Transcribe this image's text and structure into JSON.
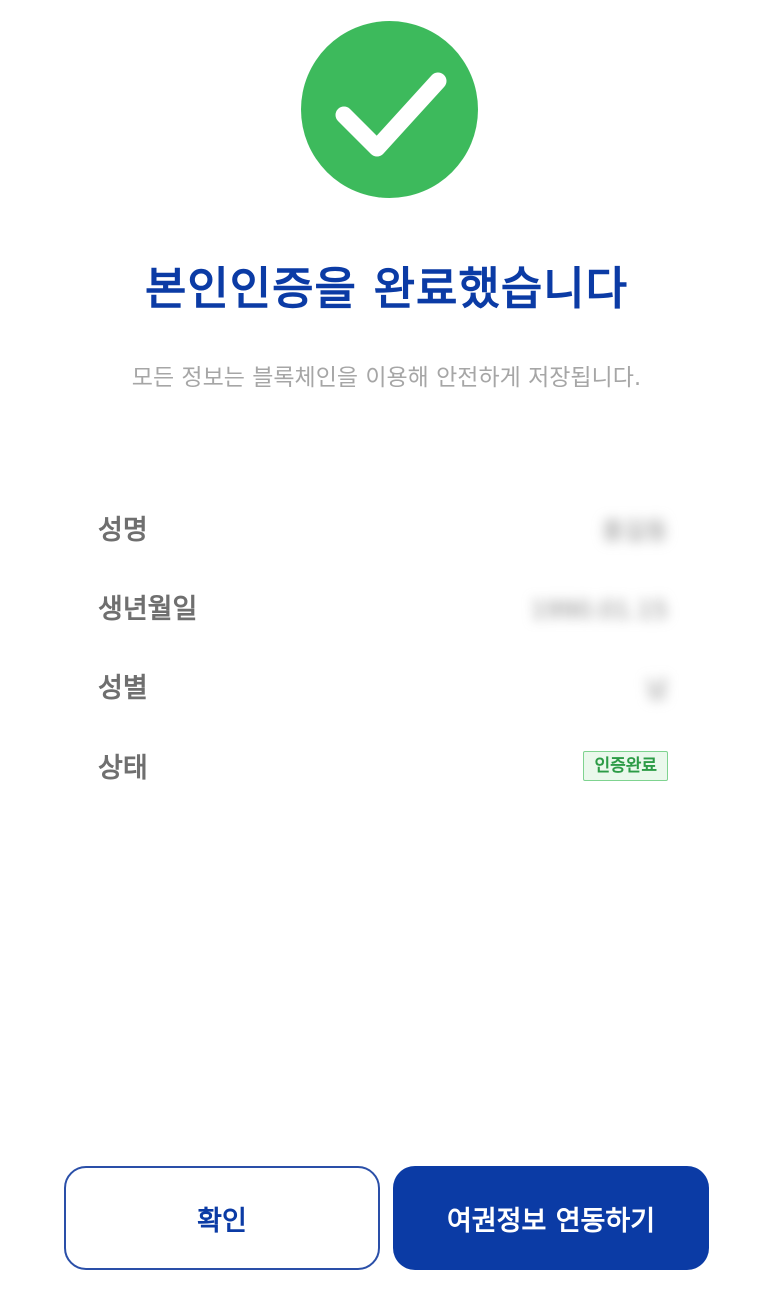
{
  "success_icon": "checkmark-icon",
  "colors": {
    "success": "#3dba5c",
    "primary": "#0b3ba5",
    "badge_bg": "#eaf8ec",
    "badge_text": "#2c9b46"
  },
  "title": "본인인증을 완료했습니다",
  "subtitle": "모든 정보는 블록체인을 이용해 안전하게 저장됩니다.",
  "info": {
    "name_label": "성명",
    "name_value": "홍길동",
    "birth_label": "생년월일",
    "birth_value": "1990.01.15",
    "gender_label": "성별",
    "gender_value": "남",
    "status_label": "상태",
    "status_value": "인증완료"
  },
  "buttons": {
    "confirm_label": "확인",
    "link_label": "여권정보 연동하기"
  }
}
